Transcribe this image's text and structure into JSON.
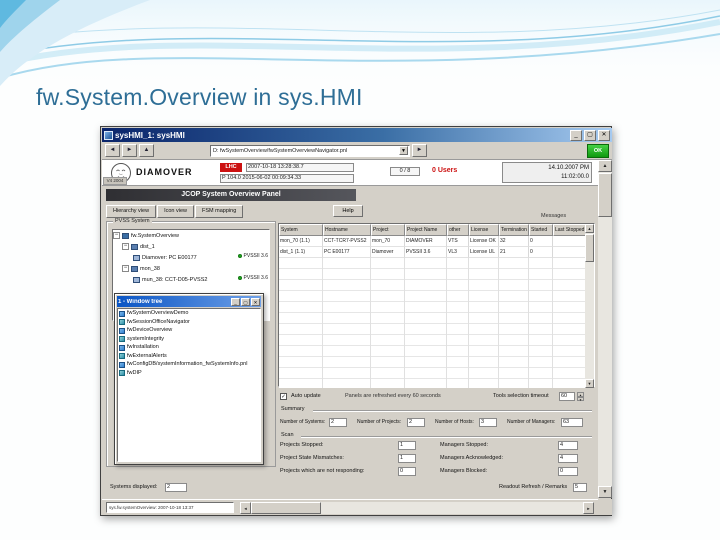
{
  "slide": {
    "title": "fw.System.Overview in sys.HMI"
  },
  "icons": {
    "minimize": "_",
    "maximize": "▢",
    "close": "✕",
    "back": "◄",
    "forward": "►",
    "up": "▲",
    "down": "▼",
    "left": "◄",
    "right": "►",
    "check": "✓",
    "expander_open": "−",
    "spin_up": "▲",
    "spin_down": "▼"
  },
  "window": {
    "title": "sysHMI_1: sysHMI",
    "toolbar": {
      "address": "D: fwSystemOverview/fwSystemOverviewNavigator.pnl",
      "indicator": "OK"
    },
    "header": {
      "version": "V4 2004",
      "brand": "DIAMOVER",
      "lhc": "LHC",
      "time1": "2007-10-18 13:28:38.7",
      "time2": "P 104.0  2015-06-02 00:09:34.33",
      "ratio": "0 / 8",
      "users": "0 Users",
      "clock_line1": "14.10.2007 PM",
      "clock_line2": "11:02:00.0"
    },
    "panel": {
      "title": "JCOP System Overview Panel",
      "tabs": [
        {
          "label": "Hierarchy view"
        },
        {
          "label": "Icon view"
        },
        {
          "label": "FSM mapping"
        }
      ],
      "help": "Help",
      "messages_label": "Messages"
    },
    "tree": {
      "group_label": "PVSS System",
      "root": "fw.SystemOverview",
      "node1": "dist_1",
      "leaf1": "Diamover: PC E00177",
      "leaf1_version": "PVSSII 3.6",
      "node2": "mon_38",
      "leaf2": "mun_38: CCT-D05-PVSS2",
      "leaf2_version": "PVSSII 3.6"
    },
    "window_tree": {
      "title": "1 - Window tree",
      "items": [
        {
          "label": "fwSystemOverviewDemo"
        },
        {
          "label": "fwSessionOfficeNavigator"
        },
        {
          "label": "fwDeviceOverview"
        },
        {
          "label": "systemIntegrity"
        },
        {
          "label": "fwInstallation"
        },
        {
          "label": "fwExternalAlerts"
        },
        {
          "label": "fwConfigDB/systemInformation_fwSystemInfo.pnl"
        },
        {
          "label": "fwDIP"
        }
      ]
    },
    "table": {
      "columns": [
        "System",
        "Hostname",
        "Project",
        "Project Name",
        "other",
        "License",
        "Termination",
        "Started",
        "Last Stopped"
      ],
      "rows": [
        [
          "mon_70 (1.1)",
          "CCT-TCR7-PVSS2",
          "mon_70",
          "DIAMOVER",
          "VTS",
          "License OK",
          "32",
          "0",
          ""
        ],
        [
          "dist_1 (1.1)",
          "PC E00177",
          "Diamover",
          "PVSSII 3.6",
          "VL3",
          "License UL",
          "21",
          "0",
          ""
        ]
      ]
    },
    "controls": {
      "auto_update": "Auto update",
      "refresh_note": "Panels are refreshed every 60 seconds",
      "timeout_label": "Tools selection timeout",
      "timeout_value": "60",
      "summary_label": "Summary",
      "summary": [
        {
          "label": "Number of Systems:",
          "value": "2"
        },
        {
          "label": "Number of Projects:",
          "value": "2"
        },
        {
          "label": "Number of Hosts:",
          "value": "3"
        },
        {
          "label": "Number of Managers:",
          "value": "63"
        }
      ],
      "scan_label": "Scan",
      "scan_rows": [
        {
          "left_label": "Projects Stopped:",
          "left_value": "1",
          "right_label": "Managers Stopped:",
          "right_value": "4"
        },
        {
          "left_label": "Project State Mismatches:",
          "left_value": "1",
          "right_label": "Managers Acknowledged:",
          "right_value": "4"
        },
        {
          "left_label": "Projects which are not responding:",
          "left_value": "0",
          "right_label": "Managers Blocked:",
          "right_value": "0"
        }
      ],
      "systems_displayed_label": "Systems displayed:",
      "systems_displayed_value": "2"
    },
    "statusbar": {
      "info": "sys.fw.systemOverview:  2007-10-18 13:37",
      "refresh_label": "Readout Refresh / Remarks",
      "refresh_value": "5"
    }
  }
}
